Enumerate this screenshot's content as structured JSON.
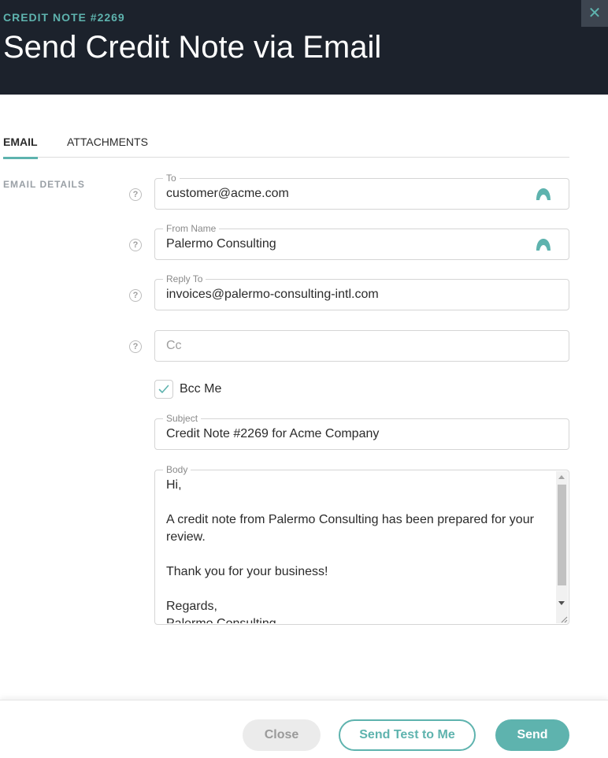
{
  "header": {
    "eyebrow": "CREDIT NOTE #2269",
    "title": "Send Credit Note via Email",
    "close_glyph": "✕"
  },
  "tabs": [
    {
      "label": "EMAIL",
      "active": true
    },
    {
      "label": "ATTACHMENTS",
      "active": false
    }
  ],
  "section": {
    "label": "EMAIL DETAILS"
  },
  "fields": {
    "to": {
      "label": "To",
      "value": "customer@acme.com"
    },
    "from_name": {
      "label": "From Name",
      "value": "Palermo Consulting"
    },
    "reply_to": {
      "label": "Reply To",
      "value": "invoices@palermo-consulting-intl.com"
    },
    "cc": {
      "label": "",
      "value": "",
      "placeholder": "Cc"
    },
    "bcc": {
      "label": "Bcc Me",
      "checked": true
    },
    "subject": {
      "label": "Subject",
      "value": "Credit Note #2269 for Acme Company"
    },
    "body": {
      "label": "Body",
      "value": "Hi,\n\nA credit note from Palermo Consulting has been prepared for your review.\n\nThank you for your business!\n\nRegards,\nPalermo Consulting"
    }
  },
  "help_glyph": "?",
  "buttons": {
    "close": "Close",
    "send_test": "Send Test to Me",
    "send": "Send"
  },
  "icons": {
    "close": "close-icon",
    "help": "help-circle-icon",
    "picker": "contact-picker-icon",
    "check": "checkmark-icon"
  },
  "colors": {
    "accent": "#5eb3ae",
    "header_bg": "#1c222c"
  }
}
